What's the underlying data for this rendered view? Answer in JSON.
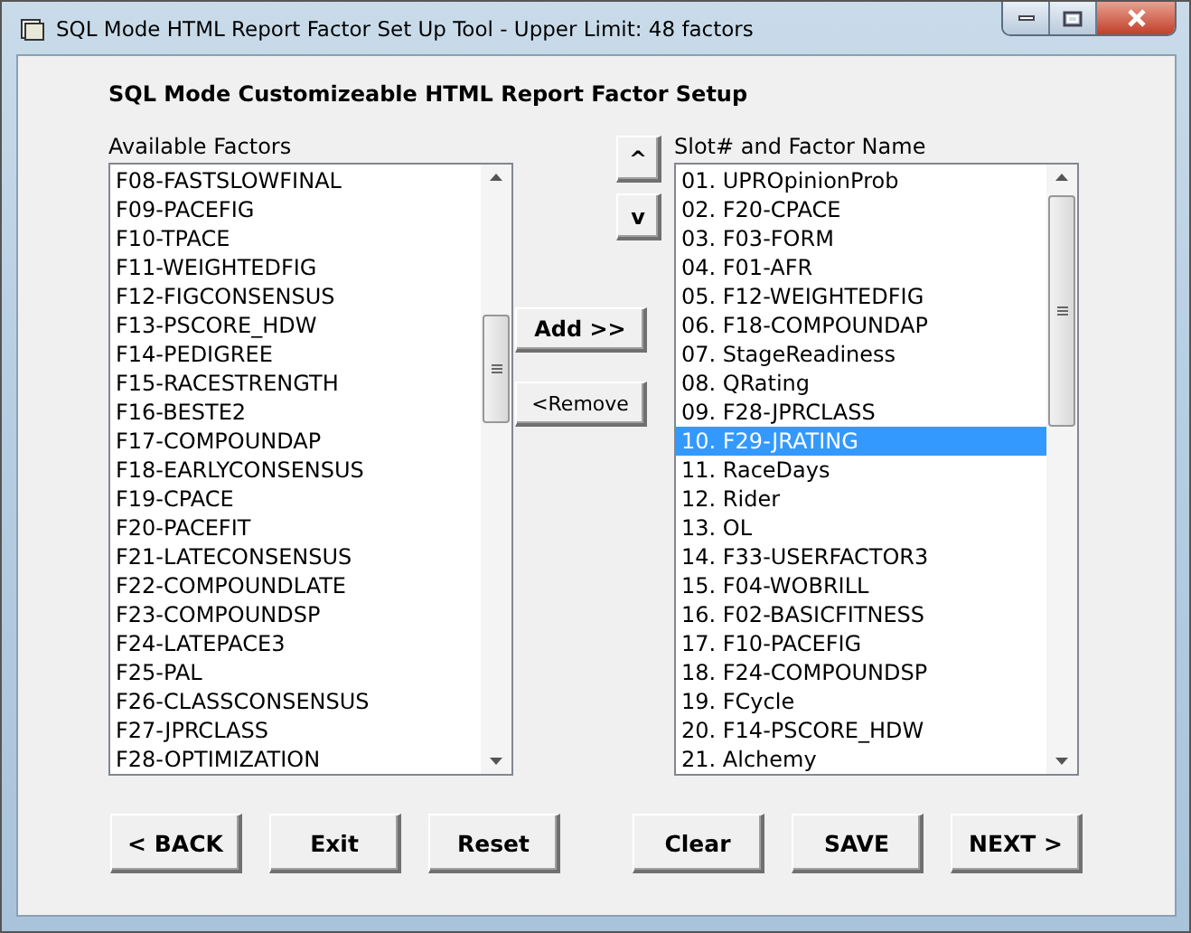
{
  "window": {
    "title": "SQL Mode HTML Report Factor Set Up Tool - Upper Limit: 48 factors"
  },
  "heading": "SQL Mode Customizeable HTML Report Factor Setup",
  "available_factors": {
    "label": "Available Factors",
    "items": [
      "F08-FASTSLOWFINAL",
      "F09-PACEFIG",
      "F10-TPACE",
      "F11-WEIGHTEDFIG",
      "F12-FIGCONSENSUS",
      "F13-PSCORE_HDW",
      "F14-PEDIGREE",
      "F15-RACESTRENGTH",
      "F16-BESTE2",
      "F17-COMPOUNDAP",
      "F18-EARLYCONSENSUS",
      "F19-CPACE",
      "F20-PACEFIT",
      "F21-LATECONSENSUS",
      "F22-COMPOUNDLATE",
      "F23-COMPOUNDSP",
      "F24-LATEPACE3",
      "F25-PAL",
      "F26-CLASSCONSENSUS",
      "F27-JPRCLASS",
      "F28-OPTIMIZATION"
    ]
  },
  "move_buttons": [
    "^",
    "v"
  ],
  "transfer_buttons": [
    "Add >>",
    "<Remove"
  ],
  "slots": {
    "label": "Slot# and Factor Name",
    "items": [
      {
        "text": "01. UPROpinionProb",
        "selected": false
      },
      {
        "text": "02. F20-CPACE",
        "selected": false
      },
      {
        "text": "03. F03-FORM",
        "selected": false
      },
      {
        "text": "04. F01-AFR",
        "selected": false
      },
      {
        "text": "05. F12-WEIGHTEDFIG",
        "selected": false
      },
      {
        "text": "06. F18-COMPOUNDAP",
        "selected": false
      },
      {
        "text": "07. StageReadiness",
        "selected": false
      },
      {
        "text": "08. QRating",
        "selected": false
      },
      {
        "text": "09. F28-JPRCLASS",
        "selected": false
      },
      {
        "text": "10. F29-JRATING",
        "selected": true
      },
      {
        "text": "11. RaceDays",
        "selected": false
      },
      {
        "text": "12. Rider",
        "selected": false
      },
      {
        "text": "13. OL",
        "selected": false
      },
      {
        "text": "14. F33-USERFACTOR3",
        "selected": false
      },
      {
        "text": "15. F04-WOBRILL",
        "selected": false
      },
      {
        "text": "16. F02-BASICFITNESS",
        "selected": false
      },
      {
        "text": "17. F10-PACEFIG",
        "selected": false
      },
      {
        "text": "18. F24-COMPOUNDSP",
        "selected": false
      },
      {
        "text": "19. FCycle",
        "selected": false
      },
      {
        "text": "20. F14-PSCORE_HDW",
        "selected": false
      },
      {
        "text": "21. Alchemy",
        "selected": false
      }
    ]
  },
  "bottom_buttons": [
    "< BACK",
    "Exit",
    "Reset",
    "Clear",
    "SAVE",
    "NEXT >"
  ]
}
